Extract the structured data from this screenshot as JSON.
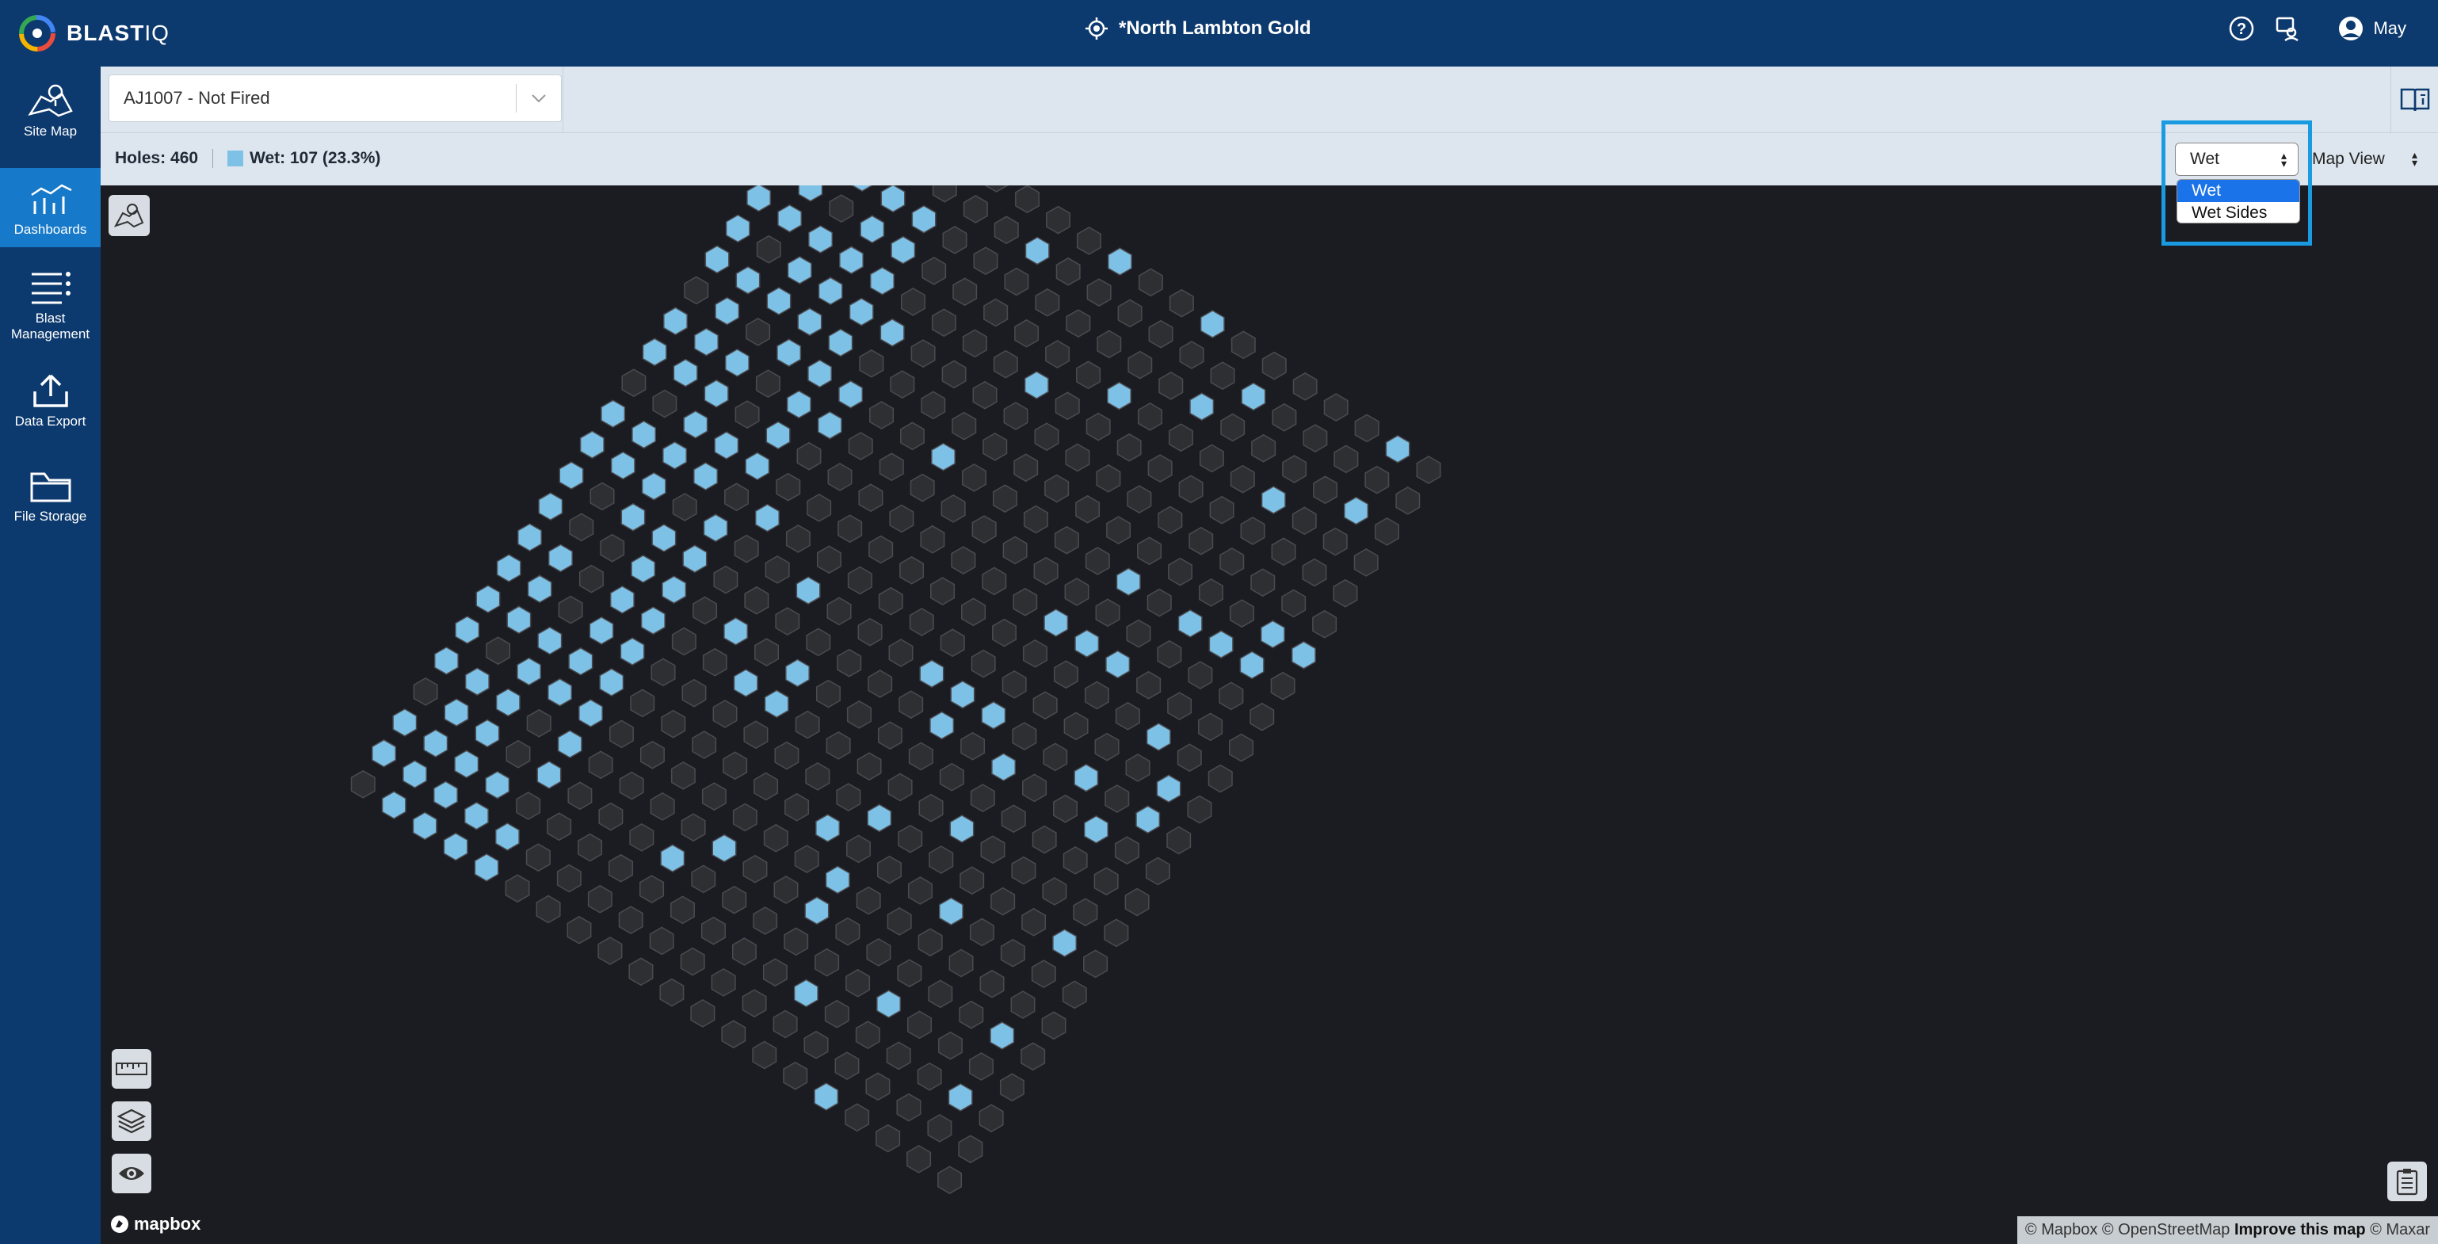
{
  "app": {
    "logo_main": "BLAST",
    "logo_sub": "IQ",
    "site_title": "*North Lambton Gold"
  },
  "user": {
    "name": "May"
  },
  "sidebar": {
    "items": [
      {
        "label": "Site Map",
        "icon": "map-icon"
      },
      {
        "label": "Dashboards",
        "icon": "dashboard-icon",
        "active": true
      },
      {
        "label": "Blast Management",
        "icon": "list-icon"
      },
      {
        "label": "Data Export",
        "icon": "upload-icon"
      },
      {
        "label": "File Storage",
        "icon": "folder-icon"
      }
    ]
  },
  "filter": {
    "blast_value": "AJ1007 - Not Fired"
  },
  "stats": {
    "holes_label": "Holes: 460",
    "wet_label": "Wet: 107 (23.3%)"
  },
  "layer_select": {
    "value": "Wet",
    "options": [
      "Wet",
      "Wet Sides"
    ]
  },
  "view_select": {
    "value": "Map View"
  },
  "colors": {
    "wet": "#7ec1e6",
    "dry": "#2e2f33",
    "hex_stroke": "#4a4b50",
    "accent": "#1a9ae0",
    "nav": "#0d3a6e",
    "nav_active": "#1679c9"
  },
  "map": {
    "attribution": [
      "© Mapbox",
      "© OpenStreetMap",
      "Improve this map",
      "© Maxar"
    ],
    "mapbox_logo": "mapbox"
  }
}
